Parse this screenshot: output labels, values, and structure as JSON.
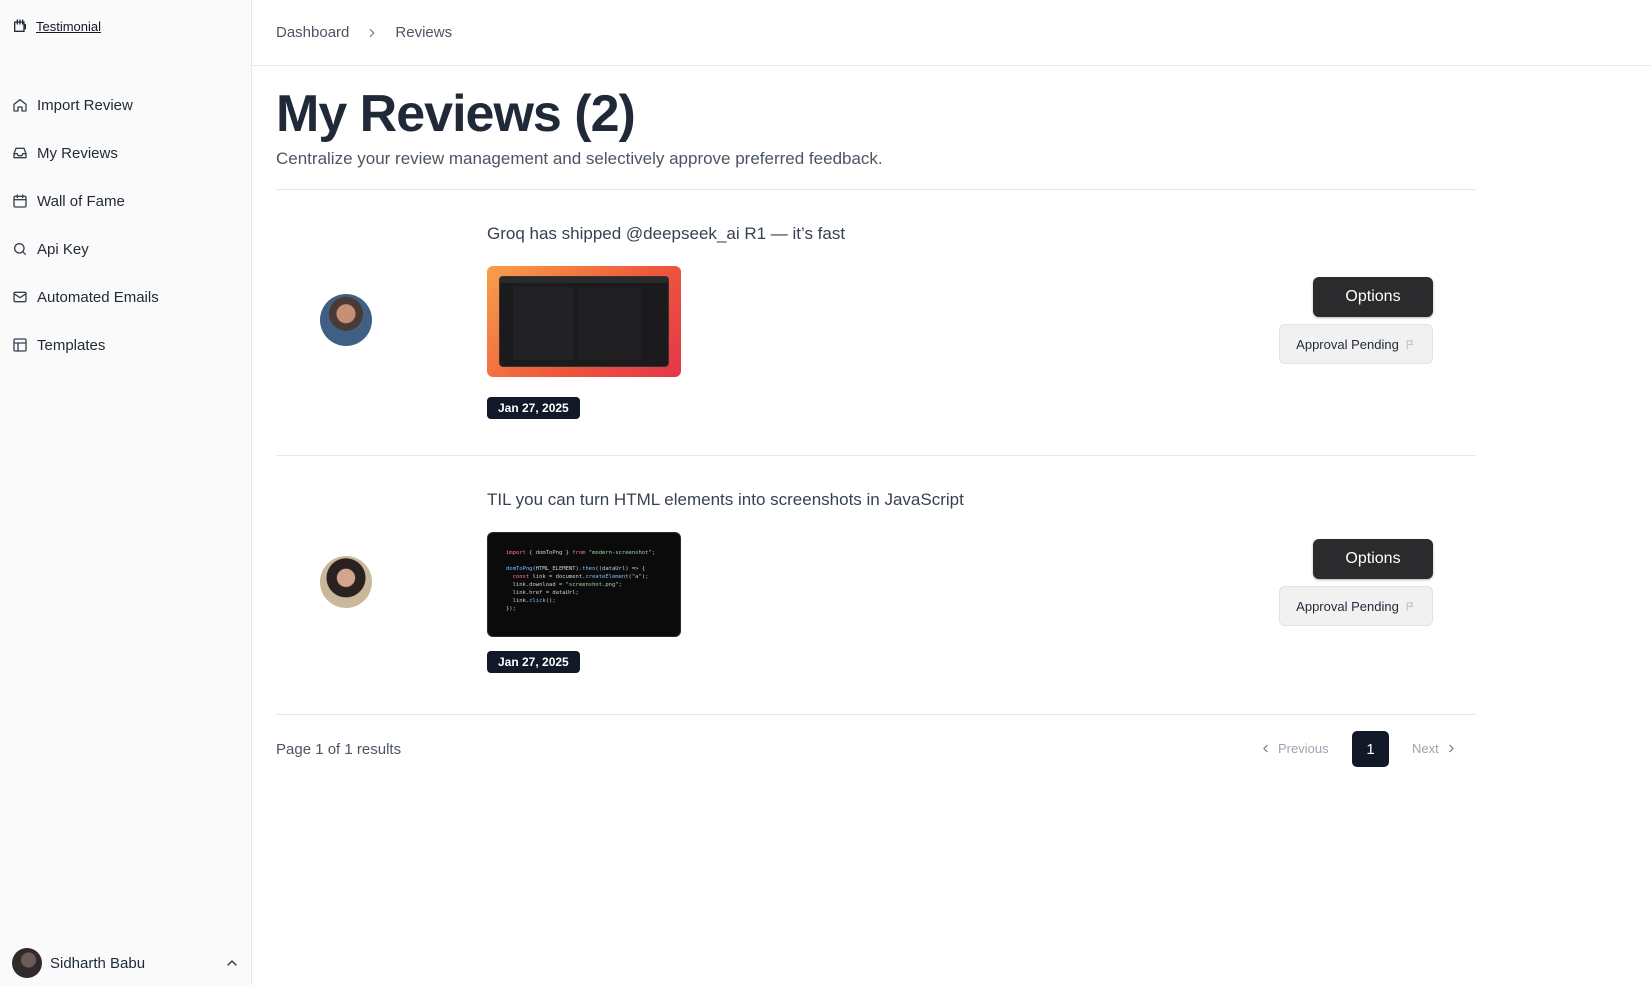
{
  "brand": {
    "label": "Testimonial",
    "icon": "testimonial-icon"
  },
  "sidebar": {
    "items": [
      {
        "label": "Import Review",
        "icon": "home-icon"
      },
      {
        "label": "My Reviews",
        "icon": "inbox-icon"
      },
      {
        "label": "Wall of Fame",
        "icon": "calendar-icon"
      },
      {
        "label": "Api Key",
        "icon": "search-icon"
      },
      {
        "label": "Automated Emails",
        "icon": "mail-icon"
      },
      {
        "label": "Templates",
        "icon": "layout-icon"
      }
    ],
    "user": {
      "name": "Sidharth Babu"
    }
  },
  "breadcrumb": {
    "items": [
      "Dashboard",
      "Reviews"
    ]
  },
  "header": {
    "title": "My Reviews (2)",
    "subtitle": "Centralize your review management and selectively approve preferred feedback."
  },
  "reviews": [
    {
      "text": "Groq has shipped @deepseek_ai R1 — it’s fast",
      "date": "Jan 27, 2025",
      "options_label": "Options",
      "status_label": "Approval Pending"
    },
    {
      "text": "TIL you can turn HTML elements into screenshots in JavaScript",
      "date": "Jan 27, 2025",
      "options_label": "Options",
      "status_label": "Approval Pending",
      "code_lines": [
        "import { domToPng } from \"modern-screenshot\";",
        "",
        "domToPng(HTML_ELEMENT).then((dataUrl) => {",
        "  const link = document.createElement(\"a\");",
        "  link.download = \"screenshot.png\";",
        "  link.href = dataUrl;",
        "  link.click();",
        "});"
      ]
    }
  ],
  "pagination": {
    "info": "Page 1 of 1 results",
    "prev_label": "Previous",
    "current_page": "1",
    "next_label": "Next"
  },
  "colors": {
    "primary_dark": "#111827",
    "button_dark": "#2b2b2d",
    "sidebar_bg": "#fafafa"
  }
}
